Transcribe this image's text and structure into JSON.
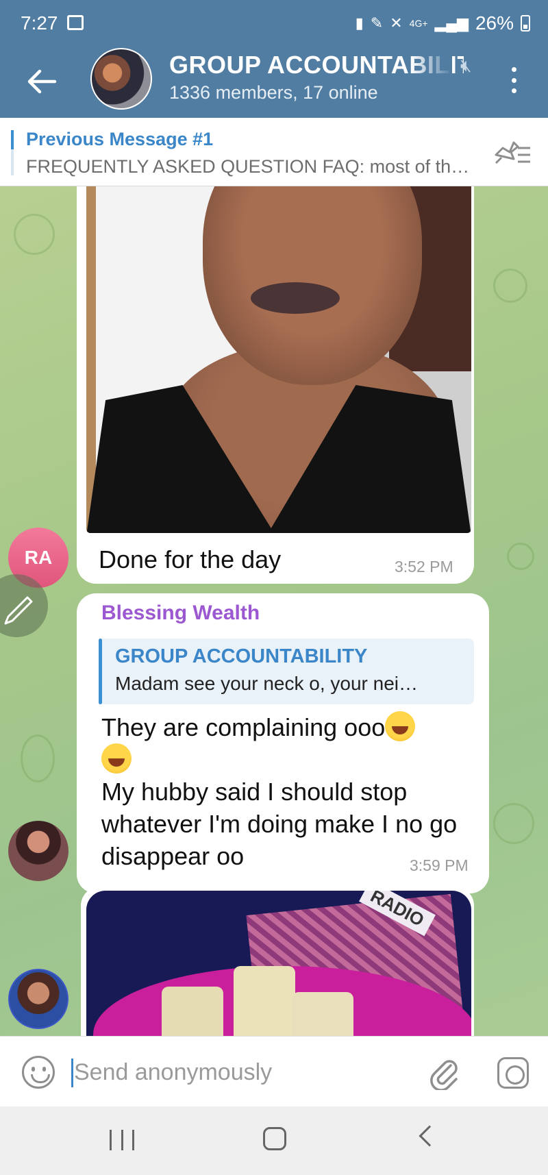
{
  "status_bar": {
    "time": "7:27",
    "network": "4G+",
    "battery": "26%",
    "icons": [
      "gallery-icon",
      "battery-saver-icon",
      "pen-icon",
      "mute-icon",
      "signal-icon",
      "battery-icon"
    ]
  },
  "header": {
    "title": "GROUP ACCOUNTABILITY",
    "subtitle": "1336 members, 17 online",
    "icons": [
      "back-arrow-icon",
      "mute-icon",
      "more-vert-icon"
    ]
  },
  "pinned": {
    "title": "Previous Message #1",
    "text": "FREQUENTLY ASKED QUESTION FAQ: most of th…"
  },
  "messages": [
    {
      "type": "photo",
      "avatar_initials": "RA",
      "caption": "Done for the day",
      "time": "3:52 PM"
    },
    {
      "type": "text",
      "sender": "Blessing Wealth",
      "reply_to": {
        "title": "GROUP ACCOUNTABILITY",
        "text": "Madam see your neck o, your nei…"
      },
      "line1": "They are complaining ooo",
      "line2": "My hubby said I should stop whatever I'm doing make I no go  disappear oo",
      "emoji": "face-with-tears-of-joy",
      "time": "3:59 PM"
    },
    {
      "type": "photo",
      "label": "RADIO"
    }
  ],
  "input": {
    "placeholder": "Send anonymously",
    "value": ""
  },
  "colors": {
    "header_bg": "#517da2",
    "accent_blue": "#3a86c8",
    "sender_purple": "#9b58d0",
    "avatar_pink": "#e0557c"
  }
}
